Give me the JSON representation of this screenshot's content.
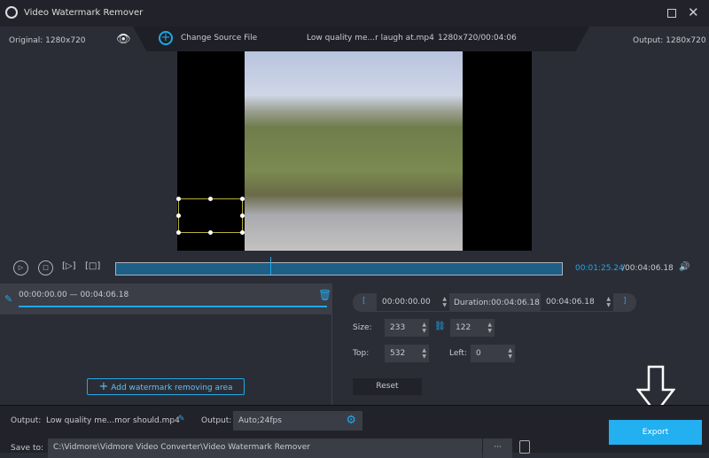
{
  "app": {
    "title": "Video Watermark Remover",
    "maximize_icon": "maximize-icon",
    "close_icon": "close-icon"
  },
  "infobar": {
    "original": "Original: 1280x720",
    "change_source": "Change Source File",
    "filename": "Low quality me...r laugh at.mp4",
    "file_info": "1280x720/00:04:06",
    "output": "Output: 1280x720"
  },
  "player": {
    "current_time": "00:01:25.24",
    "total_time": "/00:04:06.18",
    "progress": 0.346
  },
  "segment": {
    "range": "00:00:00.00 — 00:04:06.18"
  },
  "settings": {
    "start": "00:00:00.00",
    "duration": "Duration:00:04:06.18",
    "end": "00:04:06.18",
    "size_label": "Size:",
    "width": "233",
    "height": "122",
    "top_label": "Top:",
    "top": "532",
    "left_label": "Left:",
    "left": "0",
    "reset": "Reset",
    "open_bracket": "[",
    "close_bracket": "]"
  },
  "add_area": "Add watermark removing area",
  "bottom": {
    "output_label": "Output:",
    "output_file": "Low quality me...mor should.mp4",
    "format_label": "Output:",
    "format": "Auto;24fps",
    "save_label": "Save to:",
    "save_path": "C:\\Vidmore\\Vidmore Video Converter\\Video Watermark Remover",
    "browse": "···",
    "export": "Export"
  },
  "colors": {
    "accent": "#1fa8e8",
    "export_bg": "#22b0f0"
  }
}
